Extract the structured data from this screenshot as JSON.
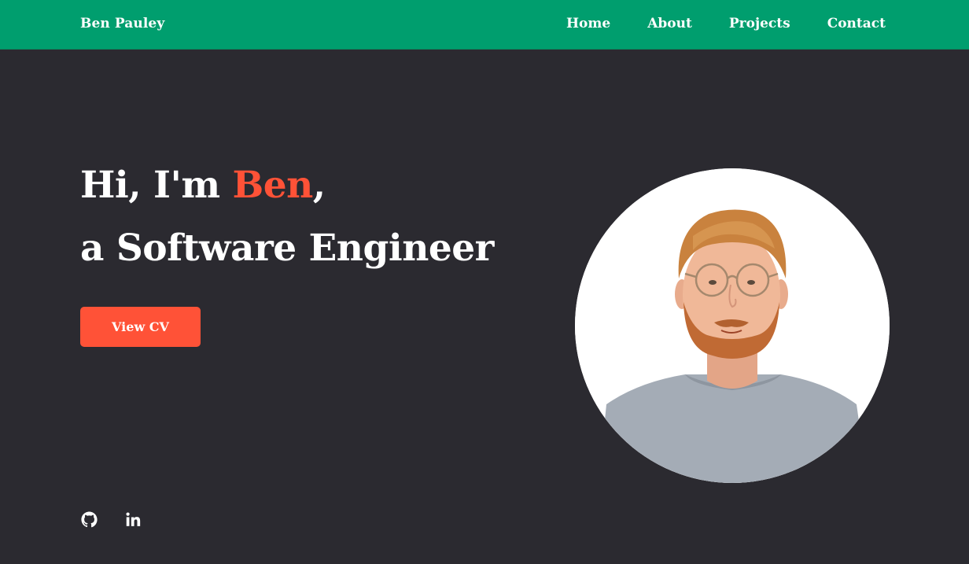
{
  "nav": {
    "brand": "Ben Pauley",
    "links": [
      {
        "label": "Home"
      },
      {
        "label": "About"
      },
      {
        "label": "Projects"
      },
      {
        "label": "Contact"
      }
    ]
  },
  "hero": {
    "greeting_prefix": "Hi, I'm ",
    "name": "Ben",
    "greeting_suffix": ",",
    "tagline": "a Software Engineer",
    "cv_button_label": "View CV",
    "avatar_icon": "profile-photo"
  },
  "socials": [
    {
      "icon": "github-icon"
    },
    {
      "icon": "linkedin-icon"
    }
  ],
  "colors": {
    "navbar": "#009e6e",
    "background": "#2b2a30",
    "accent": "#ff5237",
    "text": "#ffffff"
  }
}
